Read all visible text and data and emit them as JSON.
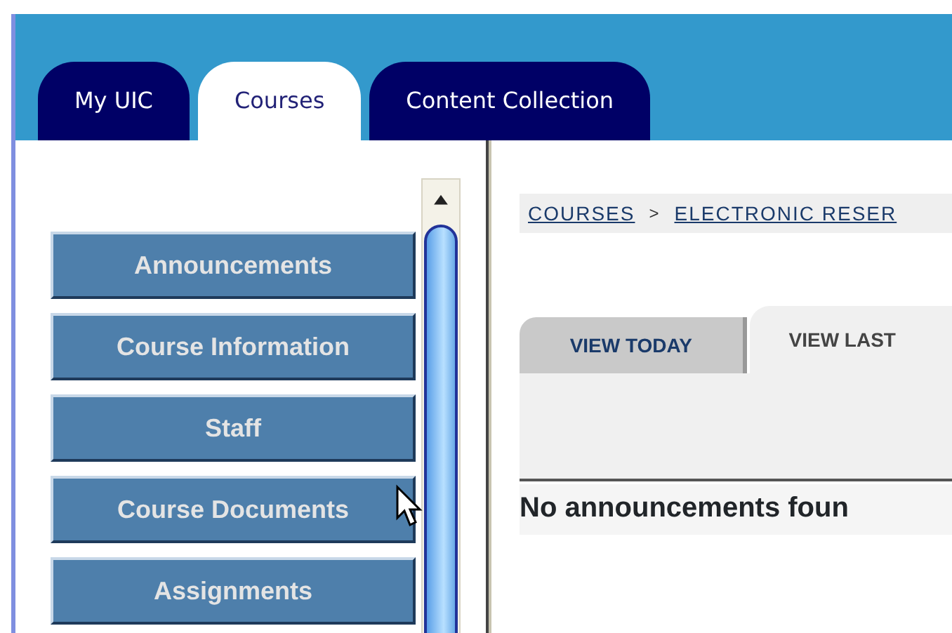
{
  "top_tabs": [
    {
      "label": "My UIC",
      "selected": false
    },
    {
      "label": "Courses",
      "selected": true
    },
    {
      "label": "Content Collection",
      "selected": false
    }
  ],
  "course_menu": [
    {
      "label": "Announcements"
    },
    {
      "label": "Course Information"
    },
    {
      "label": "Staff"
    },
    {
      "label": "Course Documents"
    },
    {
      "label": "Assignments"
    }
  ],
  "breadcrumb": {
    "items": [
      {
        "label": "COURSES"
      },
      {
        "label": "ELECTRONIC RESER"
      }
    ],
    "separator": ">"
  },
  "view_tabs": [
    {
      "label": "VIEW TODAY",
      "selected": false
    },
    {
      "label": "VIEW LAST",
      "selected": true
    }
  ],
  "message": "No announcements foun"
}
